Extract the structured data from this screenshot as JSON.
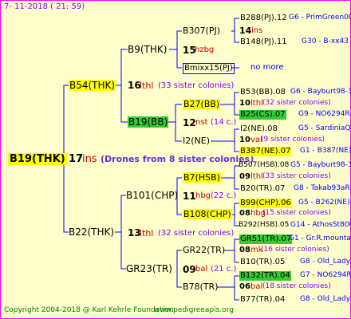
{
  "header": {
    "date": "7-  11-2018 (  21:  59)"
  },
  "footer": {
    "copyright": "Copyright 2004-2018 @ Karl Kehrle Foundation",
    "site": "www.pedigreeapis.org"
  },
  "colors": {
    "border": "#ff00ff",
    "background": "#ffffcc",
    "line": "#0000ff",
    "highlight_yellow": "#ffff00",
    "highlight_green": "#33cc33"
  },
  "root": {
    "label": "B19(THK)",
    "num": "17",
    "suffix": "ins",
    "note": "(Drones from 8 sister colonies)"
  },
  "gen1": {
    "top": {
      "label": "B54(THK)",
      "num": "16",
      "suffix": "lthl",
      "note": "(33 sister colonies)"
    },
    "bottom": {
      "label": "B22(THK)",
      "num": "13",
      "suffix": "lthl",
      "note": "(32 sister colonies)"
    }
  },
  "gen2": {
    "b9": {
      "label": "B9(THK)",
      "num": "15",
      "suffix": "hzbg"
    },
    "b19bb": {
      "label": "B19(BB)",
      "num": "12",
      "suffix": "nst",
      "note": "(14 c.)"
    },
    "b101": {
      "label": "B101(CHP)",
      "num": "11",
      "suffix": "hbg",
      "note": "(22 c.)"
    },
    "gr23": {
      "label": "GR23(TR)",
      "num": "09",
      "suffix": "bal",
      "note": "(21 c.)"
    }
  },
  "gen3": {
    "b307": {
      "label": "B307(PJ)",
      "num": "14",
      "suffix": "ins"
    },
    "bmixx": {
      "label": "Bmixx15(PJ)",
      "note": "no more"
    },
    "b27": {
      "label": "B27(BB)",
      "num": "10",
      "suffix": "lthl",
      "note": "(32 sister colonies)"
    },
    "i2": {
      "label": "I2(NE)",
      "num": "10",
      "suffix": "val",
      "note": "(9 sister colonies)"
    },
    "b7": {
      "label": "B7(HSB)",
      "num": "09",
      "suffix": "lthl",
      "note": "(33 sister colonies)"
    },
    "b108": {
      "label": "B108(CHP)",
      "num": "08",
      "suffix": "hbg",
      "note": "(15 sister colonies)"
    },
    "gr22": {
      "label": "GR22(TR)",
      "num": "08",
      "suffix": "mk",
      "note": "(16 sister colonies)"
    },
    "b78": {
      "label": "B78(TR)",
      "num": "06",
      "suffix": "bal",
      "note": "(18 sister colonies)"
    }
  },
  "gen4": [
    {
      "label": "B288(PJ).12",
      "right": "G6 - PrimGreen00"
    },
    {
      "label": "B148(PJ).11",
      "right": "G30 - B-xx43"
    },
    {
      "label": "B53(BB).08",
      "right": "G6 - Bayburt98-3"
    },
    {
      "label": "B25(CS).07",
      "right": "G9 - NO6294R"
    },
    {
      "label": "I2(NE).08",
      "right": "G5 - SardiniaQ"
    },
    {
      "label": "B387(NE).07",
      "right": "G1 - B387(NE)"
    },
    {
      "label": "B507(HSB).08",
      "right": "G5 - Bayburt98-3"
    },
    {
      "label": "B20(TR).07",
      "right": "G8 - Takab93aR"
    },
    {
      "label": "B99(CHP).06",
      "right": "G5 - B262(NE)"
    },
    {
      "label": "B292(HSB).05",
      "right": "G14 - AthosSt80R"
    },
    {
      "label": "GR51(TR).07",
      "right": "G1 - Gr.R.mounta"
    },
    {
      "label": "B10(TR).05",
      "right": "G8 - Old_Lady"
    },
    {
      "label": "B132(TR).04",
      "right": "G7 - NO6294R"
    },
    {
      "label": "B77(TR).04",
      "right": "G8 - Old_Lady"
    }
  ]
}
